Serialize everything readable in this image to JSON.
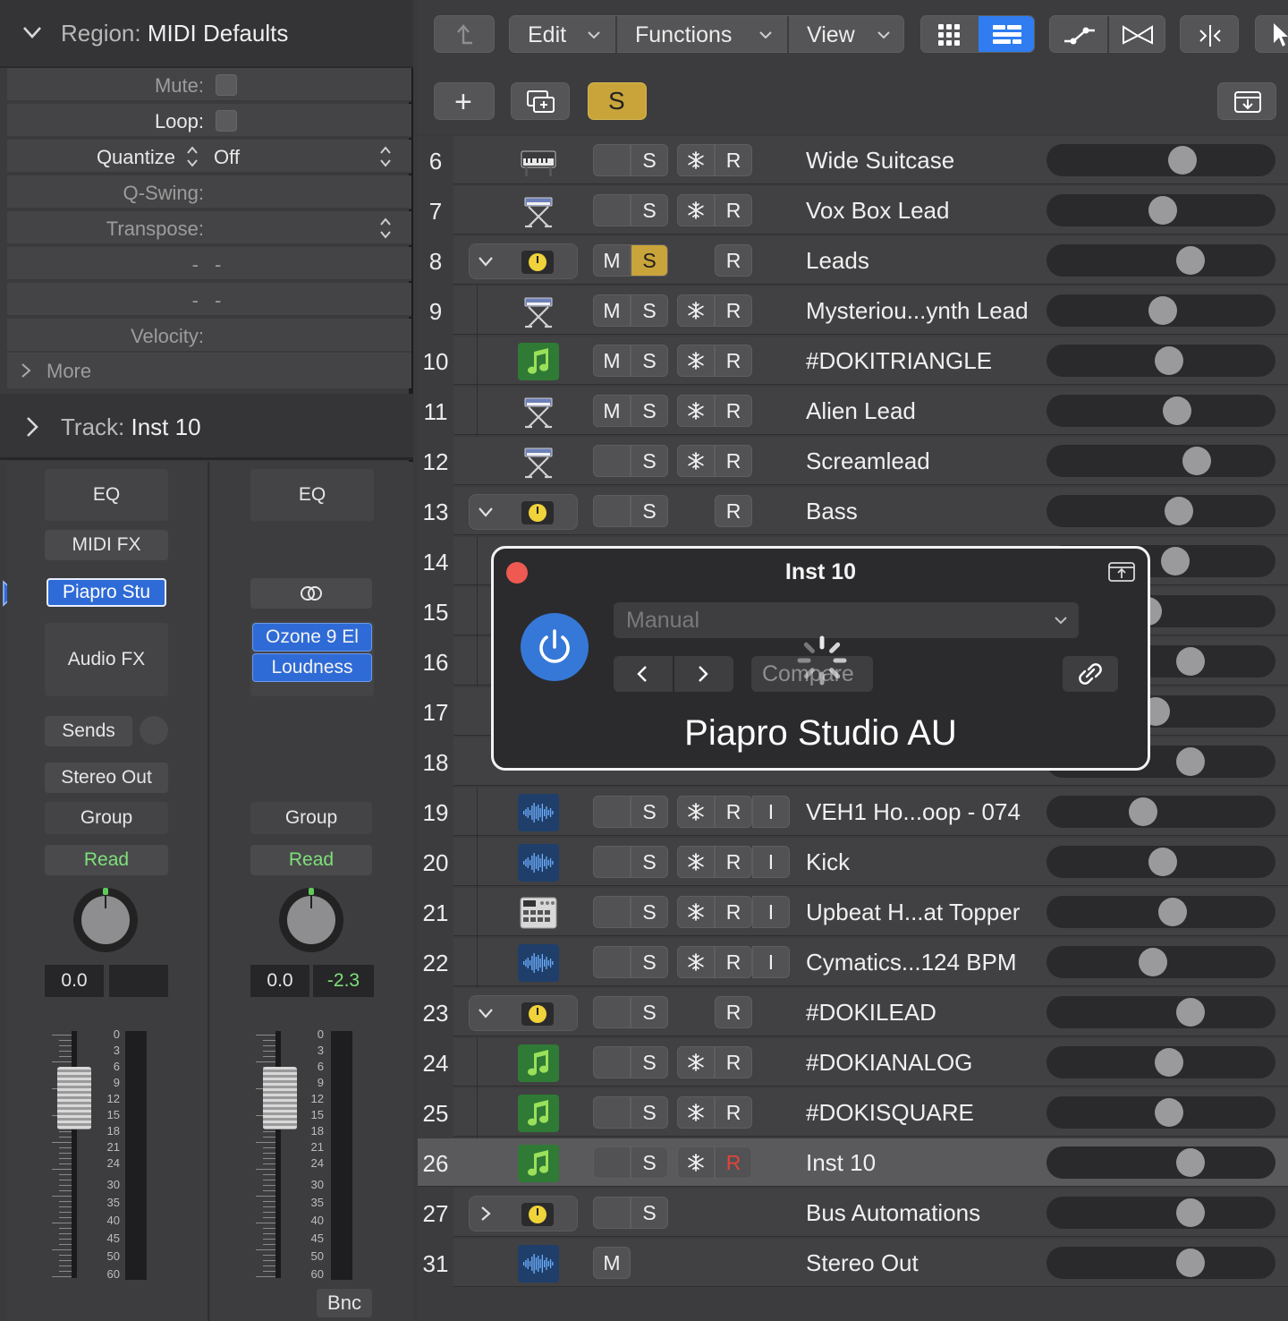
{
  "inspector": {
    "region_prefix": "Region:",
    "region_name": "MIDI Defaults",
    "params": {
      "mute": "Mute:",
      "loop": "Loop:",
      "quantize": "Quantize",
      "quantize_value": "Off",
      "qswing": "Q-Swing:",
      "transpose": "Transpose:",
      "dash1": "- -",
      "dash2": "- -",
      "velocity": "Velocity:"
    },
    "more": "More",
    "track_prefix": "Track:",
    "track_name": "Inst 10"
  },
  "strip_a": {
    "eq": "EQ",
    "midi_fx": "MIDI FX",
    "instrument": "Piapro Stu",
    "audio_fx": "Audio FX",
    "sends": "Sends",
    "output": "Stereo Out",
    "group": "Group",
    "automation": "Read",
    "volume": "0.0",
    "peak": ""
  },
  "strip_b": {
    "eq": "EQ",
    "link_icon": "stereo-link-icon",
    "plugin1": "Ozone 9 El",
    "plugin2": "Loudness",
    "group": "Group",
    "automation": "Read",
    "volume": "0.0",
    "peak": "-2.3",
    "bounce": "Bnc"
  },
  "meter_scale": [
    "0",
    "3",
    "6",
    "9",
    "12",
    "15",
    "18",
    "21",
    "24",
    "30",
    "35",
    "40",
    "45",
    "50",
    "60"
  ],
  "toolbar": {
    "edit": "Edit",
    "functions": "Functions",
    "view": "View",
    "add": "+",
    "solo": "S"
  },
  "tracks": [
    {
      "num": "6",
      "name": "Wide Suitcase",
      "icon": "keyboard-icon",
      "folder": false,
      "m": "",
      "s": "S",
      "freeze": true,
      "r": "R",
      "i": "",
      "knob": 0.62,
      "indent": 0
    },
    {
      "num": "7",
      "name": "Vox Box Lead",
      "icon": "synth-stand-icon",
      "folder": false,
      "m": "",
      "s": "S",
      "freeze": true,
      "r": "R",
      "i": "",
      "knob": 0.52,
      "indent": 0
    },
    {
      "num": "8",
      "name": "Leads",
      "icon": "clock-icon",
      "folder": true,
      "open": true,
      "m": "M",
      "s": "S",
      "solo_on": true,
      "freeze": false,
      "r": "R",
      "i": "",
      "knob": 0.66,
      "indent": 0
    },
    {
      "num": "9",
      "name": "Mysteriou...ynth Lead",
      "icon": "synth-stand-icon",
      "folder": false,
      "m": "M",
      "s": "S",
      "freeze": true,
      "r": "R",
      "i": "",
      "knob": 0.52,
      "indent": 1
    },
    {
      "num": "10",
      "name": "#DOKITRIANGLE",
      "icon": "music-note-icon",
      "folder": false,
      "m": "M",
      "s": "S",
      "freeze": true,
      "r": "R",
      "i": "",
      "knob": 0.55,
      "indent": 1
    },
    {
      "num": "11",
      "name": "Alien Lead",
      "icon": "synth-stand-icon",
      "folder": false,
      "m": "M",
      "s": "S",
      "freeze": true,
      "r": "R",
      "i": "",
      "knob": 0.59,
      "indent": 1
    },
    {
      "num": "12",
      "name": "Screamlead",
      "icon": "synth-stand-icon",
      "folder": false,
      "m": "",
      "s": "S",
      "freeze": true,
      "r": "R",
      "i": "",
      "knob": 0.69,
      "indent": 0
    },
    {
      "num": "13",
      "name": "Bass",
      "icon": "clock-icon",
      "folder": true,
      "open": true,
      "m": "",
      "s": "S",
      "freeze": false,
      "r": "R",
      "i": "",
      "knob": 0.6,
      "indent": 0
    },
    {
      "num": "14",
      "name": "",
      "icon": "",
      "folder": false,
      "hidden": true,
      "knob": 0.58,
      "indent": 1
    },
    {
      "num": "15",
      "name": "",
      "icon": "",
      "folder": false,
      "hidden": true,
      "knob": 0.44,
      "indent": 1
    },
    {
      "num": "16",
      "name": "",
      "icon": "",
      "folder": false,
      "hidden": true,
      "knob": 0.66,
      "indent": 1
    },
    {
      "num": "17",
      "name": "",
      "icon": "",
      "folder": false,
      "hidden": true,
      "knob": 0.48,
      "indent": 0
    },
    {
      "num": "18",
      "name": "",
      "icon": "",
      "folder": false,
      "hidden": true,
      "knob": 0.66,
      "indent": 0
    },
    {
      "num": "19",
      "name": "VEH1 Ho...oop - 074",
      "icon": "waveform-icon",
      "folder": false,
      "m": "",
      "s": "S",
      "freeze": true,
      "r": "R",
      "i": "I",
      "knob": 0.42,
      "indent": 1
    },
    {
      "num": "20",
      "name": "Kick",
      "icon": "waveform-icon",
      "folder": false,
      "m": "",
      "s": "S",
      "freeze": true,
      "r": "R",
      "i": "I",
      "knob": 0.52,
      "indent": 1
    },
    {
      "num": "21",
      "name": "Upbeat H...at Topper",
      "icon": "drum-machine-icon",
      "folder": false,
      "m": "",
      "s": "S",
      "freeze": true,
      "r": "R",
      "i": "I",
      "knob": 0.57,
      "indent": 1
    },
    {
      "num": "22",
      "name": "Cymatics...124 BPM",
      "icon": "waveform-icon",
      "folder": false,
      "m": "",
      "s": "S",
      "freeze": true,
      "r": "R",
      "i": "I",
      "knob": 0.47,
      "indent": 1
    },
    {
      "num": "23",
      "name": "#DOKILEAD",
      "icon": "clock-icon",
      "folder": true,
      "open": true,
      "m": "",
      "s": "S",
      "freeze": false,
      "r": "R",
      "i": "",
      "knob": 0.66,
      "indent": 0
    },
    {
      "num": "24",
      "name": "#DOKIANALOG",
      "icon": "music-note-icon",
      "folder": false,
      "m": "",
      "s": "S",
      "freeze": true,
      "r": "R",
      "i": "",
      "knob": 0.55,
      "indent": 1
    },
    {
      "num": "25",
      "name": "#DOKISQUARE",
      "icon": "music-note-icon",
      "folder": false,
      "m": "",
      "s": "S",
      "freeze": true,
      "r": "R",
      "i": "",
      "knob": 0.55,
      "indent": 1
    },
    {
      "num": "26",
      "name": "Inst 10",
      "icon": "music-note-icon",
      "folder": false,
      "selected": true,
      "m": "",
      "s": "S",
      "freeze": true,
      "r": "R",
      "rec_red": true,
      "i": "",
      "knob": 0.66,
      "indent": 0
    },
    {
      "num": "27",
      "name": "Bus Automations",
      "icon": "clock-icon",
      "folder": true,
      "open": false,
      "m": "",
      "s": "S",
      "freeze": false,
      "r": "",
      "i": "",
      "knob": 0.66,
      "indent": 0
    },
    {
      "num": "31",
      "name": "Stereo Out",
      "icon": "waveform-icon",
      "folder": false,
      "m": "M",
      "s": "",
      "freeze": false,
      "r": "",
      "i": "",
      "knob": 0.66,
      "indent": 0
    }
  ],
  "plugin_window": {
    "title": "Inst 10",
    "preset": "Manual",
    "compare": "Compare",
    "plugin_name": "Piapro Studio AU"
  },
  "colors": {
    "solo_yellow": "#c9a43a",
    "accent_blue": "#2f7df0",
    "record_red": "#e0453a",
    "read_green": "#7ee07a"
  }
}
